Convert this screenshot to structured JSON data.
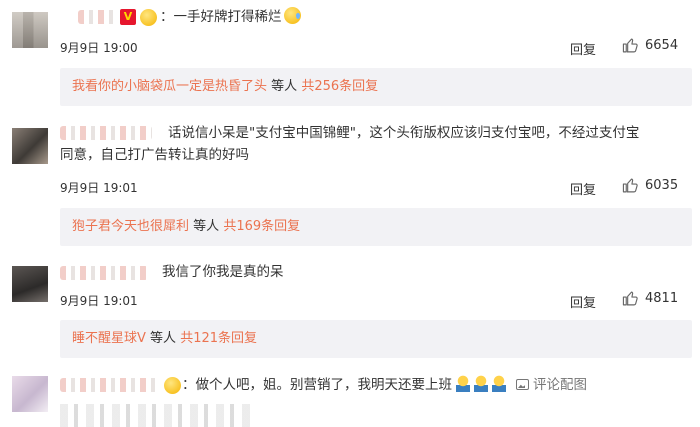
{
  "comments": [
    {
      "text": "：一手好牌打得稀烂",
      "date": "9月9日 19:00",
      "reply_label": "回复",
      "likes": "6654",
      "sub": {
        "first_user": "我看你的小脑袋瓜一定是热昏了头",
        "others": "等人",
        "count_label": "共256条回复"
      }
    },
    {
      "text_line1": "话说信小呆是\"支付宝中国锦鲤\"，这个头衔版权应该归支付宝吧，不经过支付宝",
      "text_line2": "同意，自己打广告转让真的好吗",
      "date": "9月9日 19:01",
      "reply_label": "回复",
      "likes": "6035",
      "sub": {
        "first_user": "狍子君今天也很犀利",
        "others": "等人",
        "count_label": "共169条回复"
      }
    },
    {
      "text": "我信了你我是真的呆",
      "date": "9月9日 19:01",
      "reply_label": "回复",
      "likes": "4811",
      "sub": {
        "first_user": "睡不醒星球V",
        "others": "等人",
        "count_label": "共121条回复"
      }
    },
    {
      "text": "：做个人吧，姐。别营销了，我明天还要上班",
      "view_pic_label": "评论配图"
    }
  ],
  "icons": {
    "verified": "vip-v-badge-icon",
    "like": "thumbs-up-icon",
    "image": "image-icon"
  },
  "colors": {
    "accent": "#eb7350",
    "sub_box_bg": "#f2f2f5"
  }
}
